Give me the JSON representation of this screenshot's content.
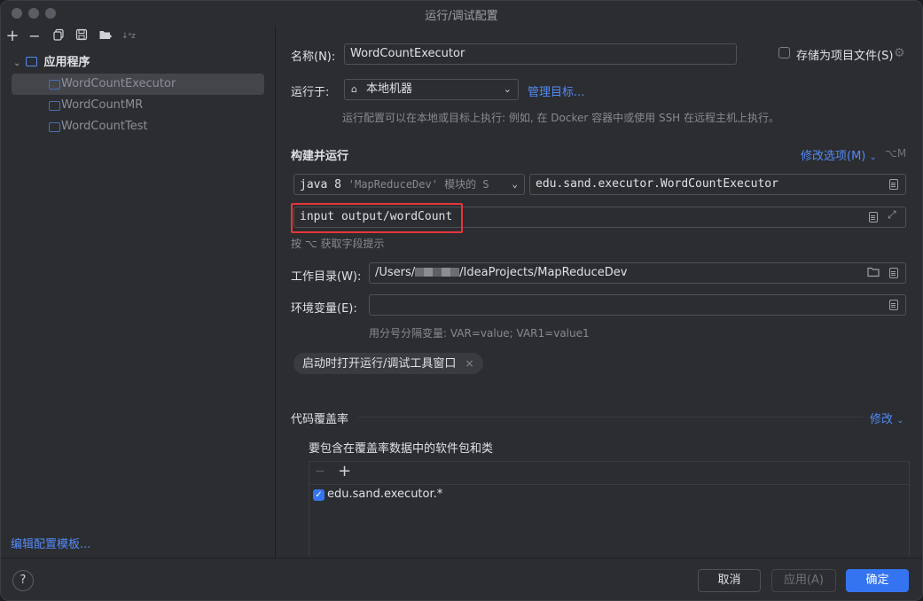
{
  "window": {
    "title": "运行/调试配置"
  },
  "sidebar": {
    "group_label": "应用程序",
    "items": [
      {
        "label": "WordCountExecutor"
      },
      {
        "label": "WordCountMR"
      },
      {
        "label": "WordCountTest"
      }
    ],
    "edit_templates_link": "编辑配置模板..."
  },
  "form": {
    "name_label": "名称(N):",
    "name_value": "WordCountExecutor",
    "store_as_project_file": "存储为项目文件(S)",
    "run_on_label": "运行于:",
    "run_on_value": "本地机器",
    "manage_targets": "管理目标...",
    "run_on_hint": "运行配置可以在本地或目标上执行: 例如, 在 Docker 容器中或使用 SSH 在远程主机上执行。",
    "build_run_title": "构建并运行",
    "modify_options": "修改选项(M)",
    "modify_shortcut": "⌥M",
    "jdk_value": "java 8",
    "jdk_module": "'MapReduceDev' 模块的 S",
    "main_class": "edu.sand.executor.WordCountExecutor",
    "program_args": "input output/wordCount",
    "args_hint": "按 ⌥ 获取字段提示",
    "workdir_label": "工作目录(W):",
    "workdir_prefix": "/Users/",
    "workdir_suffix": "/IdeaProjects/MapReduceDev",
    "env_label": "环境变量(E):",
    "env_hint": "用分号分隔变量: VAR=value; VAR1=value1",
    "chip_label": "启动时打开运行/调试工具窗口",
    "coverage_title": "代码覆盖率",
    "coverage_modify": "修改",
    "coverage_sub": "要包含在覆盖率数据中的软件包和类",
    "coverage_items": [
      {
        "label": "edu.sand.executor.*",
        "checked": true
      }
    ]
  },
  "footer": {
    "help": "?",
    "cancel": "取消",
    "apply": "应用(A)",
    "ok": "确定"
  }
}
